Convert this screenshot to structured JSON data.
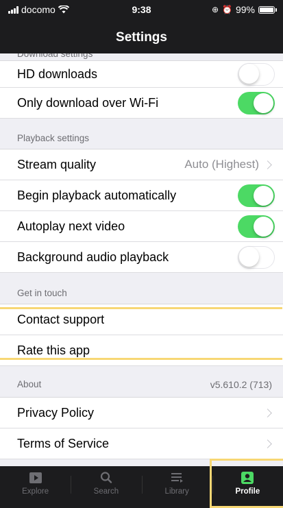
{
  "status": {
    "carrier": "docomo",
    "time": "9:38",
    "battery": "99%"
  },
  "nav": {
    "title": "Settings"
  },
  "sections": [
    {
      "header": "Download settings",
      "rows": [
        {
          "label": "HD downloads",
          "control": "toggle",
          "on": false
        },
        {
          "label": "Only download over Wi-Fi",
          "control": "toggle",
          "on": true
        }
      ]
    },
    {
      "header": "Playback settings",
      "rows": [
        {
          "label": "Stream quality",
          "value": "Auto (Highest)",
          "control": "disclosure"
        },
        {
          "label": "Begin playback automatically",
          "control": "toggle",
          "on": true
        },
        {
          "label": "Autoplay next video",
          "control": "toggle",
          "on": true
        },
        {
          "label": "Background audio playback",
          "control": "toggle",
          "on": false
        }
      ]
    },
    {
      "header": "Get in touch",
      "rows": [
        {
          "label": "Contact support"
        },
        {
          "label": "Rate this app"
        }
      ]
    },
    {
      "header": "About",
      "header_value": "v5.610.2 (713)",
      "rows": [
        {
          "label": "Privacy Policy",
          "control": "disclosure"
        },
        {
          "label": "Terms of Service",
          "control": "disclosure"
        }
      ]
    }
  ],
  "tabs": [
    {
      "label": "Explore",
      "icon": "play-icon",
      "active": false
    },
    {
      "label": "Search",
      "icon": "search-icon",
      "active": false
    },
    {
      "label": "Library",
      "icon": "library-icon",
      "active": false
    },
    {
      "label": "Profile",
      "icon": "profile-icon",
      "active": true
    }
  ],
  "colors": {
    "toggle_on": "#4cd964",
    "highlight": "#f7d774",
    "bar": "#1c1c1e"
  }
}
